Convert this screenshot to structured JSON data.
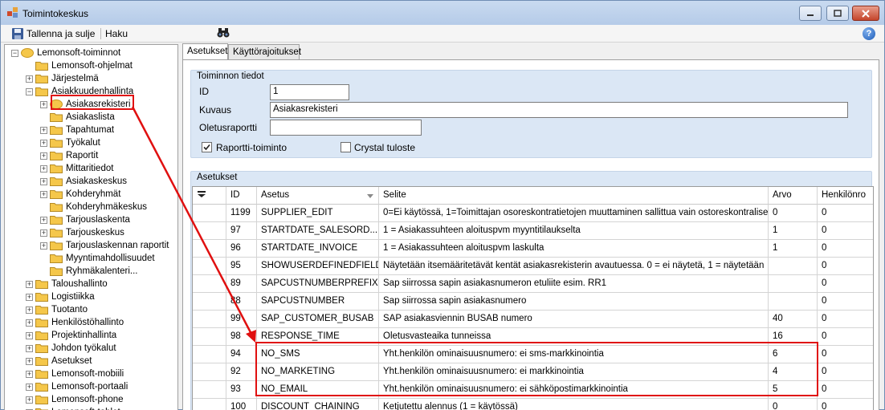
{
  "window": {
    "title": "Toimintokeskus"
  },
  "toolbar": {
    "save_label": "Tallenna ja sulje",
    "search_label": "Haku",
    "help_label": "?"
  },
  "tree": {
    "items": [
      {
        "label": "Lemonsoft-toiminnot",
        "level": 0,
        "expander": "−"
      },
      {
        "label": "Lemonsoft-ohjelmat",
        "level": 1,
        "expander": ""
      },
      {
        "label": "Järjestelmä",
        "level": 1,
        "expander": "+"
      },
      {
        "label": "Asiakkuudenhallinta",
        "level": 1,
        "expander": "−"
      },
      {
        "label": "Asiakasrekisteri",
        "level": 2,
        "expander": "+"
      },
      {
        "label": "Asiakaslista",
        "level": 2,
        "expander": ""
      },
      {
        "label": "Tapahtumat",
        "level": 2,
        "expander": "+"
      },
      {
        "label": "Työkalut",
        "level": 2,
        "expander": "+"
      },
      {
        "label": "Raportit",
        "level": 2,
        "expander": "+"
      },
      {
        "label": "Mittaritiedot",
        "level": 2,
        "expander": "+"
      },
      {
        "label": "Asiakaskeskus",
        "level": 2,
        "expander": "+"
      },
      {
        "label": "Kohderyhmät",
        "level": 2,
        "expander": "+"
      },
      {
        "label": "Kohderyhmäkeskus",
        "level": 2,
        "expander": ""
      },
      {
        "label": "Tarjouslaskenta",
        "level": 2,
        "expander": "+"
      },
      {
        "label": "Tarjouskeskus",
        "level": 2,
        "expander": "+"
      },
      {
        "label": "Tarjouslaskennan raportit",
        "level": 2,
        "expander": "+"
      },
      {
        "label": "Myyntimahdollisuudet",
        "level": 2,
        "expander": ""
      },
      {
        "label": "Ryhmäkalenteri...",
        "level": 2,
        "expander": ""
      },
      {
        "label": "Taloushallinto",
        "level": 1,
        "expander": "+"
      },
      {
        "label": "Logistiikka",
        "level": 1,
        "expander": "+"
      },
      {
        "label": "Tuotanto",
        "level": 1,
        "expander": "+"
      },
      {
        "label": "Henkilöstöhallinto",
        "level": 1,
        "expander": "+"
      },
      {
        "label": "Projektinhallinta",
        "level": 1,
        "expander": "+"
      },
      {
        "label": "Johdon työkalut",
        "level": 1,
        "expander": "+"
      },
      {
        "label": "Asetukset",
        "level": 1,
        "expander": "+"
      },
      {
        "label": "Lemonsoft-mobiili",
        "level": 1,
        "expander": "+"
      },
      {
        "label": "Lemonsoft-portaali",
        "level": 1,
        "expander": "+"
      },
      {
        "label": "Lemonsoft-phone",
        "level": 1,
        "expander": "+"
      },
      {
        "label": "Lemonsoft-tablet",
        "level": 1,
        "expander": "+"
      }
    ]
  },
  "tabs": [
    {
      "label": "Asetukset",
      "active": true
    },
    {
      "label": "Käyttörajoitukset",
      "active": false
    }
  ],
  "info_group": {
    "title": "Toiminnon tiedot",
    "id_label": "ID",
    "id_value": "1",
    "desc_label": "Kuvaus",
    "desc_value": "Asiakasrekisteri",
    "report_label": "Oletusraportti",
    "report_value": "",
    "report_function_label": "Raportti-toiminto",
    "report_function_checked": true,
    "crystal_label": "Crystal tuloste",
    "crystal_checked": false
  },
  "settings_group": {
    "title": "Asetukset",
    "columns": [
      "ID",
      "Asetus",
      "Selite",
      "Arvo",
      "Henkilönro"
    ],
    "rows": [
      {
        "id": "1199",
        "name": "SUPPLIER_EDIT",
        "desc": "0=Ei käytössä, 1=Toimittajan osoreskontratietojen muuttaminen sallittua vain ostoreskontralisenssiellä",
        "value": "0",
        "person": "0"
      },
      {
        "id": "97",
        "name": "STARTDATE_SALESORD...",
        "desc": "1 = Asiakassuhteen aloituspvm myyntitilaukselta",
        "value": "1",
        "person": "0"
      },
      {
        "id": "96",
        "name": "STARTDATE_INVOICE",
        "desc": "1 = Asiakassuhteen aloituspvm laskulta",
        "value": "1",
        "person": "0"
      },
      {
        "id": "95",
        "name": "SHOWUSERDEFINEDFIELD",
        "desc": "Näytetään itsemääritetävät kentät asiakasrekisterin avautuessa. 0 = ei näytetä, 1 = näytetään",
        "value": "",
        "person": "0"
      },
      {
        "id": "89",
        "name": "SAPCUSTNUMBERPREFIX",
        "desc": "Sap siirrossa sapin asiakasnumeron etuliite esim. RR1",
        "value": "",
        "person": "0"
      },
      {
        "id": "88",
        "name": "SAPCUSTNUMBER",
        "desc": "Sap siirrossa sapin asiakasnumero",
        "value": "",
        "person": "0"
      },
      {
        "id": "99",
        "name": "SAP_CUSTOMER_BUSAB",
        "desc": "SAP asiakasviennin BUSAB numero",
        "value": "40",
        "person": "0"
      },
      {
        "id": "98",
        "name": "RESPONSE_TIME",
        "desc": "Oletusvasteaika tunneissa",
        "value": "16",
        "person": "0"
      },
      {
        "id": "94",
        "name": "NO_SMS",
        "desc": "Yht.henkilön ominaisuusnumero: ei sms-markkinointia",
        "value": "6",
        "person": "0"
      },
      {
        "id": "92",
        "name": "NO_MARKETING",
        "desc": "Yht.henkilön ominaisuusnumero: ei markkinointia",
        "value": "4",
        "person": "0"
      },
      {
        "id": "93",
        "name": "NO_EMAIL",
        "desc": "Yht.henkilön ominaisuusnumero: ei sähköpostimarkkinointia",
        "value": "5",
        "person": "0"
      },
      {
        "id": "100",
        "name": "DISCOUNT_CHAINING",
        "desc": "Ketjutettu alennus (1 = käytössä)",
        "value": "0",
        "person": "0"
      }
    ]
  },
  "colors": {
    "highlight": "#e01010",
    "group_bg": "#dbe7f5",
    "folder": "#f5c74a"
  }
}
